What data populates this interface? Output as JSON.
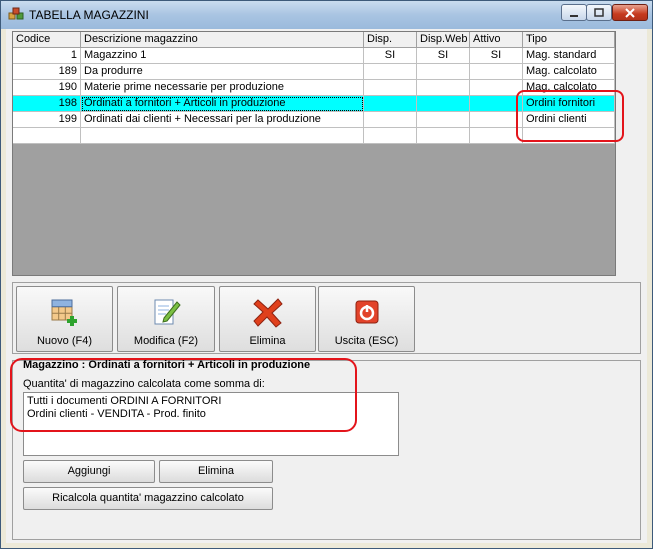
{
  "window": {
    "title": "TABELLA MAGAZZINI"
  },
  "grid": {
    "columns": [
      "Codice",
      "Descrizione magazzino",
      "Disp.",
      "Disp.Web",
      "Attivo",
      "Tipo"
    ],
    "rows": [
      {
        "codice": "1",
        "descrizione": "Magazzino 1",
        "disp": "SI",
        "disp_web": "SI",
        "attivo": "SI",
        "tipo": "Mag. standard"
      },
      {
        "codice": "189",
        "descrizione": "Da produrre",
        "disp": "",
        "disp_web": "",
        "attivo": "",
        "tipo": "Mag. calcolato"
      },
      {
        "codice": "190",
        "descrizione": "Materie prime necessarie per produzione",
        "disp": "",
        "disp_web": "",
        "attivo": "",
        "tipo": "Mag. calcolato"
      },
      {
        "codice": "198",
        "descrizione": "Ordinati a fornitori + Articoli in produzione",
        "disp": "",
        "disp_web": "",
        "attivo": "",
        "tipo": "Ordini fornitori"
      },
      {
        "codice": "199",
        "descrizione": "Ordinati dai clienti + Necessari per la produzione",
        "disp": "",
        "disp_web": "",
        "attivo": "",
        "tipo": "Ordini clienti"
      }
    ]
  },
  "toolbar": {
    "new_label": "Nuovo (F4)",
    "edit_label": "Modifica (F2)",
    "delete_label": "Elimina",
    "exit_label": "Uscita (ESC)"
  },
  "panel": {
    "title": "Magazzino : Ordinati a fornitori + Articoli in produzione",
    "subtitle": "Quantita' di magazzino calcolata come somma di:",
    "items": [
      "Tutti i documenti ORDINI A FORNITORI",
      "Ordini clienti - VENDITA - Prod. finito"
    ],
    "add_label": "Aggiungi",
    "remove_label": "Elimina",
    "recalc_label": "Ricalcola quantita' magazzino calcolato"
  },
  "colors": {
    "selection": "#00ffff",
    "highlight": "#e3141b"
  }
}
